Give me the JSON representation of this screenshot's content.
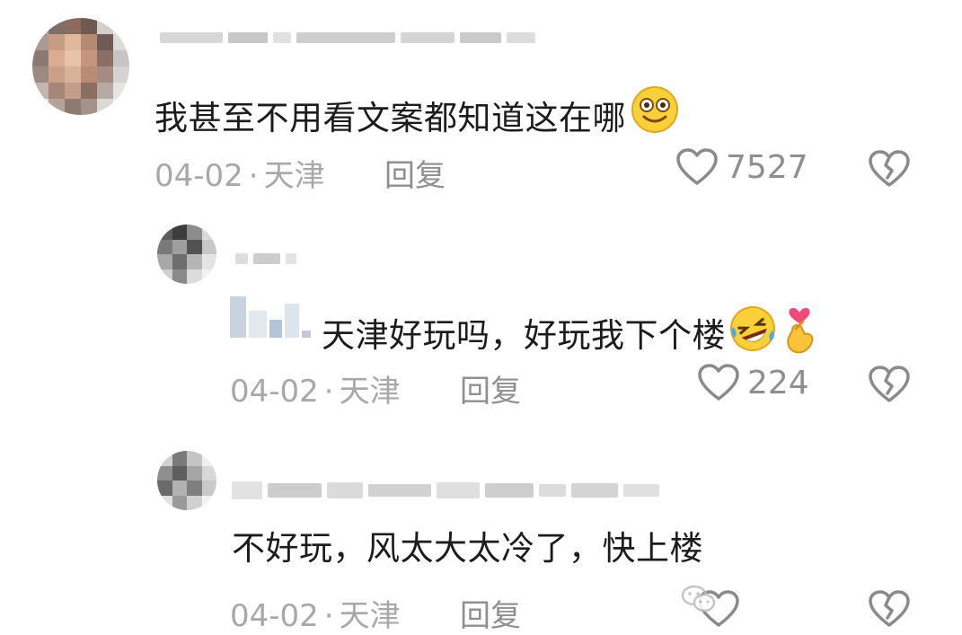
{
  "comments": [
    {
      "text": "我甚至不用看文案都知道这在哪",
      "emoji": "smiling-face-emoji",
      "date": "04-02",
      "separator": "·",
      "location": "天津",
      "reply_label": "回复",
      "likes": "7527"
    },
    {
      "text": "天津好玩吗，好玩我下个楼",
      "emoji": [
        "rolling-laughing-emoji",
        "finger-heart-emoji"
      ],
      "date": "04-02",
      "separator": "·",
      "location": "天津",
      "reply_label": "回复",
      "likes": "224"
    },
    {
      "text": "不好玩，风太大太冷了，快上楼",
      "date": "04-02",
      "separator": "·",
      "location": "天津",
      "reply_label": "回复"
    }
  ],
  "colors": {
    "text": "#1c1c1c",
    "meta": "#a8a8a8",
    "icon": "#8a8a8a"
  }
}
